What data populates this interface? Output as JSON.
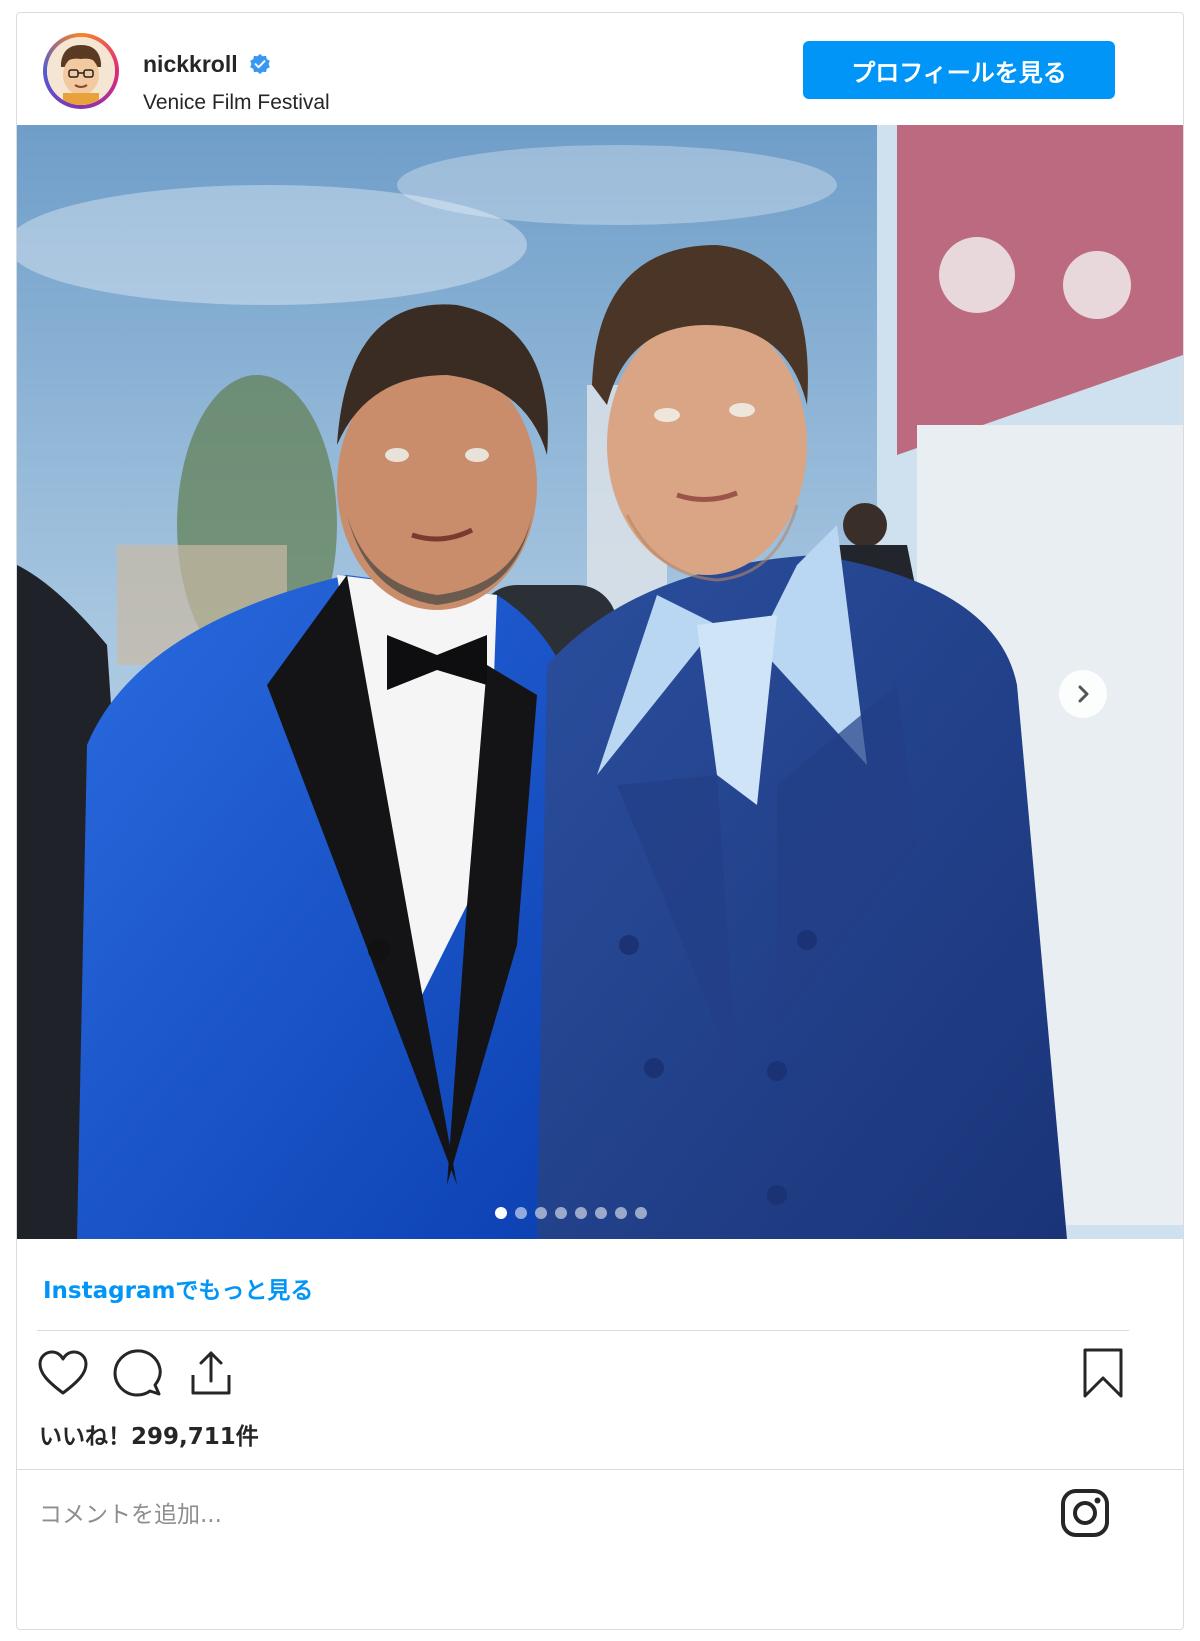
{
  "header": {
    "username": "nickkroll",
    "location": "Venice Film Festival",
    "profile_button": "プロフィールを見る",
    "verified": true
  },
  "photo": {
    "carousel_total": 8,
    "carousel_active_index": 1,
    "next_icon": "chevron-right-icon"
  },
  "footer": {
    "more_link": "Instagramでもっと見る",
    "likes": "いいね！299,711件",
    "comment_placeholder": "コメントを追加...",
    "icons": [
      "heart-icon",
      "comment-icon",
      "share-icon",
      "bookmark-icon",
      "instagram-icon"
    ]
  },
  "colors": {
    "accent": "#0095f6",
    "border": "#dbdbdb",
    "text": "#262626",
    "muted": "#8e8e8e"
  }
}
